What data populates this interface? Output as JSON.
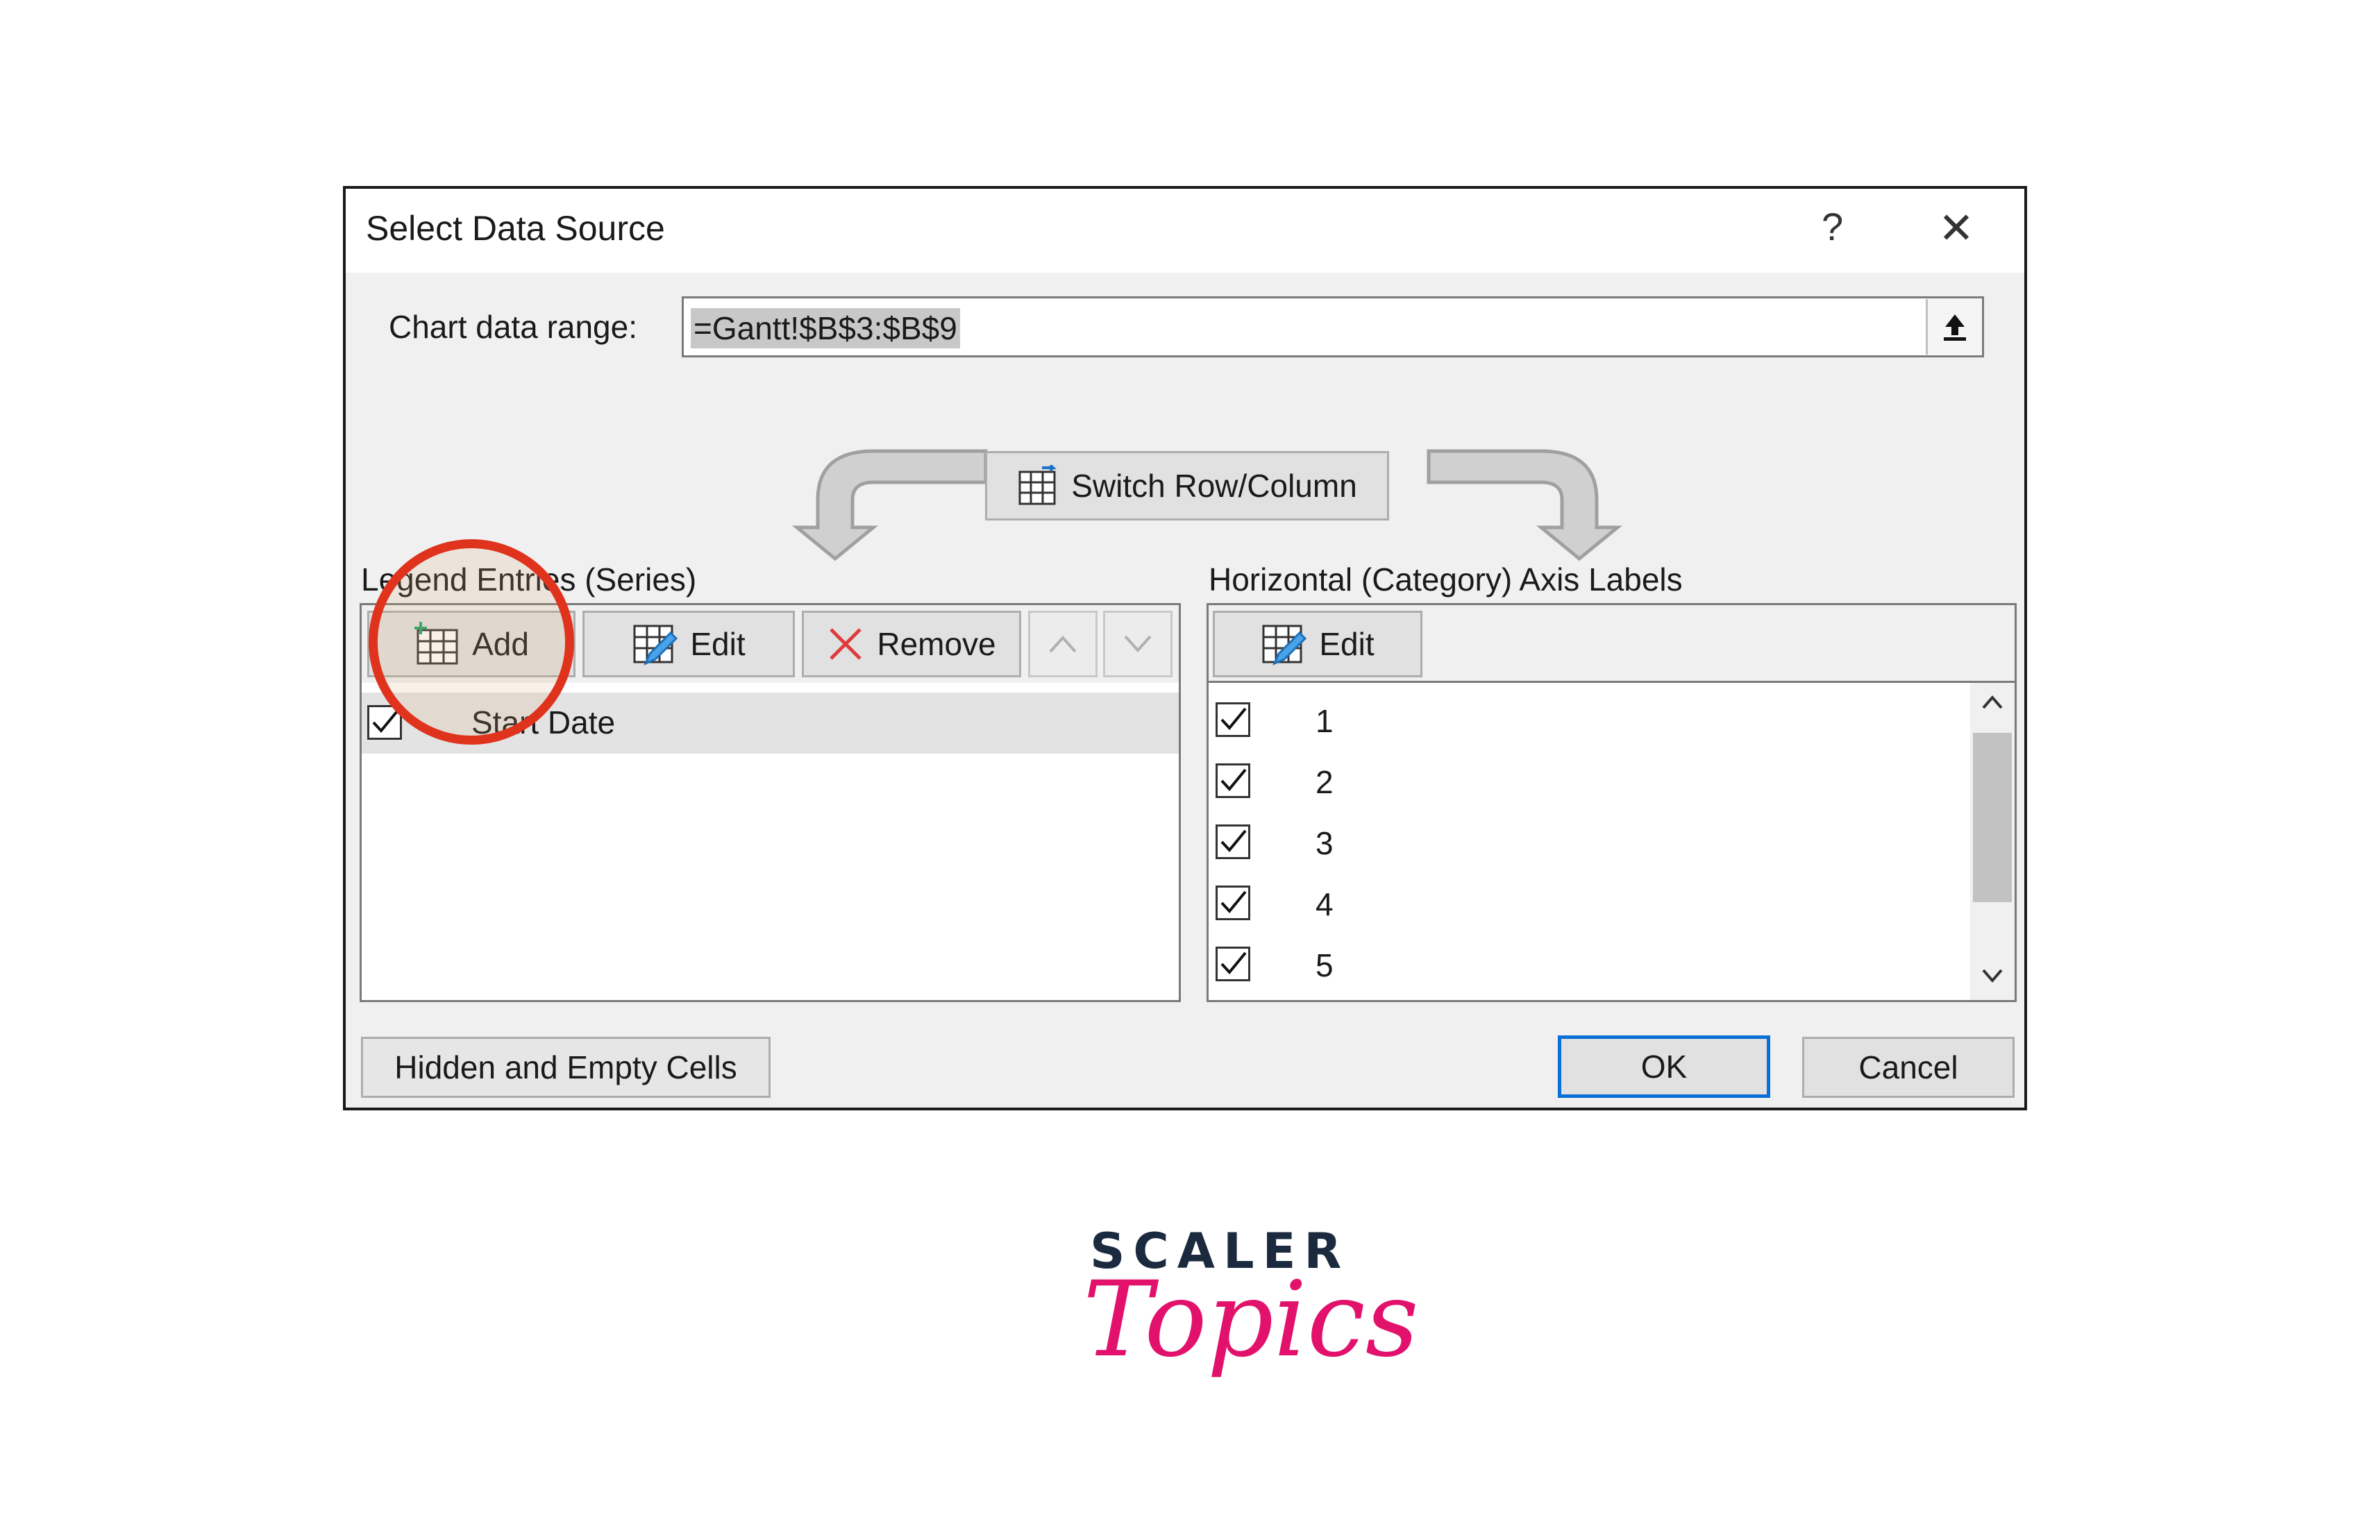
{
  "dialog": {
    "title": "Select Data Source",
    "help_label": "?",
    "close_label": "✕",
    "chart_range_label": "Chart data range:",
    "chart_range_value": "=Gantt!$B$3:$B$9",
    "switch_label": "Switch Row/Column",
    "legend_header": "Legend Entries (Series)",
    "legend_buttons": {
      "add": "Add",
      "edit": "Edit",
      "remove": "Remove"
    },
    "series": [
      {
        "label": "Start Date",
        "checked": true
      }
    ],
    "axis_header": "Horizontal (Category) Axis Labels",
    "axis_edit": "Edit",
    "axis_labels": [
      {
        "label": "1",
        "checked": true
      },
      {
        "label": "2",
        "checked": true
      },
      {
        "label": "3",
        "checked": true
      },
      {
        "label": "4",
        "checked": true
      },
      {
        "label": "5",
        "checked": true
      }
    ],
    "hidden_cells_button": "Hidden and Empty Cells",
    "ok_button": "OK",
    "cancel_button": "Cancel"
  },
  "brand": {
    "line1": "SCALER",
    "line2": "Topics",
    "accent_color": "#e2126c",
    "dark_color": "#1b2a3f"
  },
  "highlight_color": "#e0331d"
}
